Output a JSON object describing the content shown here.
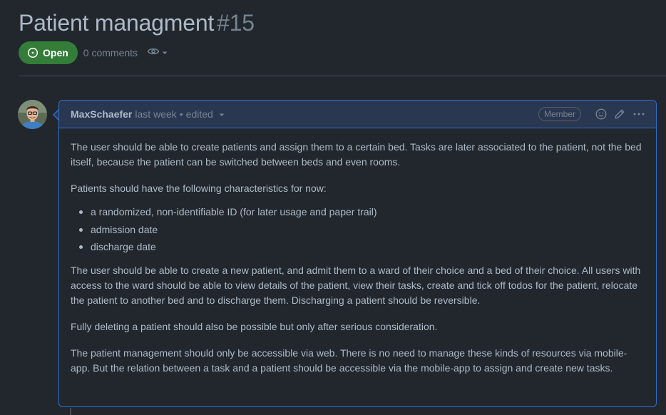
{
  "issue": {
    "title": "Patient managment",
    "number": "#15",
    "state": "Open",
    "comments_count": "0 comments"
  },
  "icons": {
    "state": "issue-opened-icon",
    "watch": "eye-icon",
    "reaction": "smiley-icon",
    "edit": "pencil-icon",
    "more": "kebab-horizontal-icon"
  },
  "colors": {
    "open_badge": "#347d39",
    "comment_border": "#316dca",
    "header_bg": "#2a3750",
    "page_bg": "#22272e"
  },
  "comment": {
    "author": "MaxSchaefer",
    "timestamp": "last week",
    "separator": "•",
    "edited_label": "edited",
    "role": "Member",
    "paragraph_1": "The user should be able to create patients and assign them to a certain bed. Tasks are later associated to the patient, not the bed itself, because the patient can be switched between beds and even rooms.",
    "paragraph_2": "Patients should have the following characteristics for now:",
    "list_items": [
      "a randomized, non-identifiable ID (for later usage and paper trail)",
      "admission date",
      "discharge date"
    ],
    "paragraph_3": "The user should be able to create a new patient, and admit them to a ward of their choice and a bed of their choice. All users with access to the ward should be able to view details of the patient, view their tasks, create and tick off todos for the patient, relocate the patient to another bed and to discharge them. Discharging a patient should be reversible.",
    "paragraph_4": "Fully deleting a patient should also be possible but only after serious consideration.",
    "paragraph_5": "The patient management should only be accessible via web. There is no need to manage these kinds of resources via mobile-app. But the relation between a task and a patient should be accessible via the mobile-app to assign and create new tasks."
  }
}
